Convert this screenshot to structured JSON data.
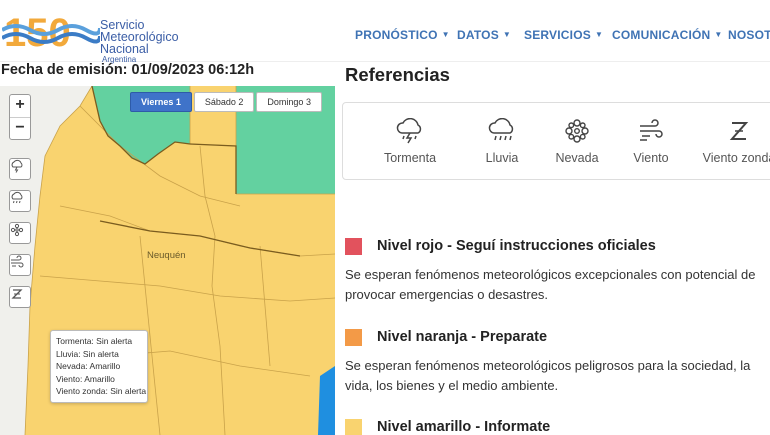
{
  "header": {
    "logo_number": "150",
    "logo_lines": [
      "Servicio",
      "Meteorológico",
      "Nacional"
    ],
    "logo_country": "Argentina",
    "nav": [
      {
        "label": "PRONÓSTICO",
        "caret": "▼"
      },
      {
        "label": "DATOS",
        "caret": "▼"
      },
      {
        "label": "SERVICIOS",
        "caret": "▼"
      },
      {
        "label": "COMUNICACIÓN",
        "caret": "▼"
      },
      {
        "label": "NOSOTR",
        "caret": ""
      }
    ]
  },
  "fecha": "Fecha de emisión: 01/09/2023 06:12h",
  "map": {
    "zoom_in": "+",
    "zoom_out": "−",
    "tools": [
      "storm-icon",
      "rain-icon",
      "snow-icon",
      "wind-icon",
      "zonda-icon"
    ],
    "days": [
      {
        "label": "Viernes 1",
        "active": true
      },
      {
        "label": "Sábado 2",
        "active": false
      },
      {
        "label": "Domingo 3",
        "active": false
      }
    ],
    "city": "Neuquén",
    "popup": [
      "Tormenta: Sin alerta",
      "Lluvia: Sin alerta",
      "Nevada: Amarillo",
      "Viento: Amarillo",
      "Viento zonda: Sin alerta"
    ],
    "colors": {
      "yellow": "#f9d36f",
      "green": "#63d1a0",
      "blue": "#1f8fe0"
    }
  },
  "referencias": {
    "title": "Referencias",
    "items": [
      {
        "label": "Tormenta",
        "icon": "storm-icon"
      },
      {
        "label": "Lluvia",
        "icon": "rain-icon"
      },
      {
        "label": "Nevada",
        "icon": "snow-icon"
      },
      {
        "label": "Viento",
        "icon": "wind-icon"
      },
      {
        "label": "Viento zonda",
        "icon": "zonda-icon"
      }
    ]
  },
  "niveles": [
    {
      "color": "#e2525d",
      "title": "Nivel rojo - Seguí instrucciones oficiales",
      "desc": "Se esperan fenómenos meteorológicos excepcionales con potencial de provocar emergencias o desastres."
    },
    {
      "color": "#f39a47",
      "title": "Nivel naranja - Preparate",
      "desc": "Se esperan fenómenos meteorológicos peligrosos para la sociedad, la vida, los bienes y el medio ambiente."
    },
    {
      "color": "#f9d36f",
      "title": "Nivel amarillo - Informate",
      "desc": ""
    }
  ]
}
